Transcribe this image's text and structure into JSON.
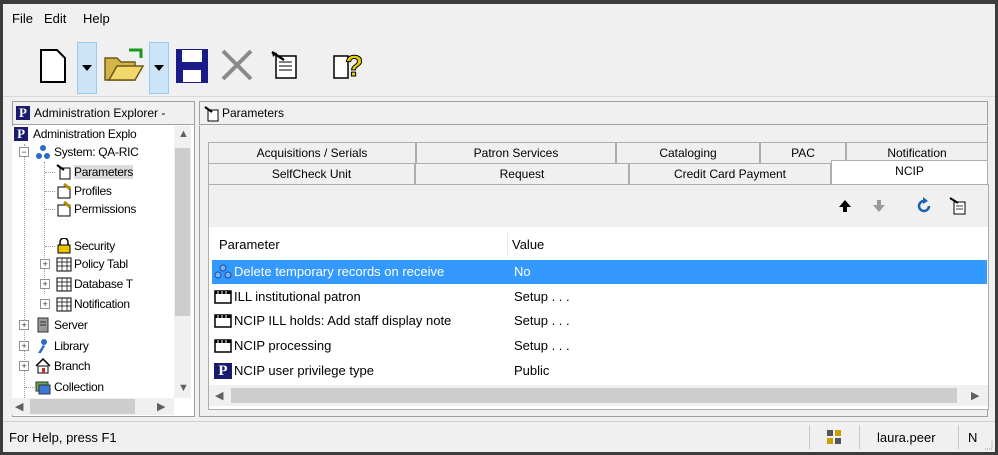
{
  "menu": [
    "File",
    "Edit",
    "Help"
  ],
  "left_pane": {
    "title": "Administration Explorer -",
    "tree": [
      {
        "label": "Administration Explo",
        "icon": "polaris-p-icon"
      },
      {
        "label": "System: QA-RIC",
        "icon": "network-icon"
      },
      {
        "label": "Parameters",
        "icon": "parameters-icon"
      },
      {
        "label": "Profiles",
        "icon": "profiles-icon"
      },
      {
        "label": "Permissions",
        "icon": "permissions-icon"
      },
      {
        "label": "Security",
        "icon": "lock-icon"
      },
      {
        "label": "Policy Tabl",
        "icon": "table-icon"
      },
      {
        "label": "Database T",
        "icon": "table-icon"
      },
      {
        "label": "Notification",
        "icon": "table-icon"
      },
      {
        "label": "Server",
        "icon": "server-icon"
      },
      {
        "label": "Library",
        "icon": "library-icon"
      },
      {
        "label": "Branch",
        "icon": "branch-icon"
      },
      {
        "label": "Collection",
        "icon": "collection-icon"
      }
    ]
  },
  "right_pane": {
    "title": "Parameters",
    "tabs_row1": [
      "Acquisitions / Serials",
      "Patron Services",
      "Cataloging",
      "PAC",
      "Notification"
    ],
    "tabs_row2": [
      "SelfCheck Unit",
      "Request",
      "Credit Card Payment",
      "NCIP"
    ],
    "active_tab": "NCIP",
    "columns": [
      "Parameter",
      "Value"
    ],
    "rows": [
      {
        "parameter": "Delete temporary records on receive",
        "value": "No",
        "icon": "users-icon",
        "selected": true
      },
      {
        "parameter": "ILL institutional patron",
        "value": "Setup . . .",
        "icon": "film-icon"
      },
      {
        "parameter": "NCIP ILL holds: Add staff display note",
        "value": "Setup . . .",
        "icon": "film-icon"
      },
      {
        "parameter": "NCIP processing",
        "value": "Setup . . .",
        "icon": "film-icon"
      },
      {
        "parameter": "NCIP user privilege type",
        "value": "Public",
        "icon": "polaris-p-icon"
      }
    ]
  },
  "status": {
    "help": "For Help, press F1",
    "user": "laura.peer",
    "extra": "N"
  },
  "colors": {
    "selection": "#3399ff",
    "toolbar_selected": "#cce4f7"
  }
}
